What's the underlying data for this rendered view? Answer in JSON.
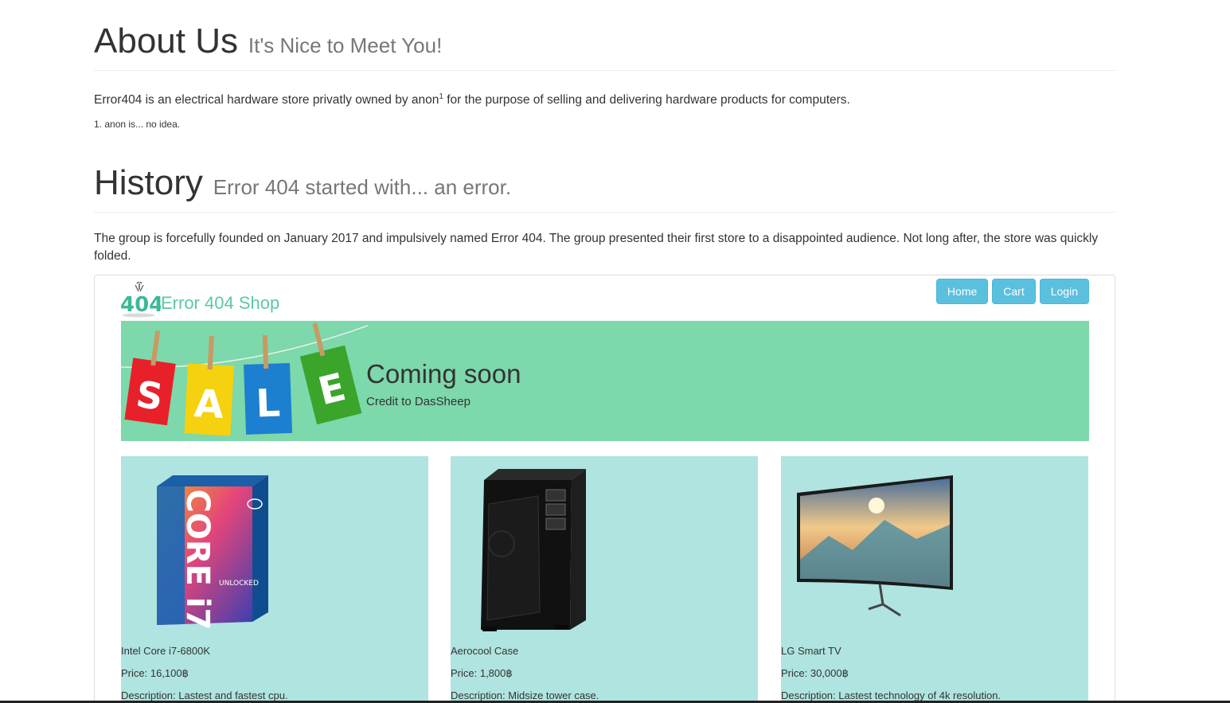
{
  "about": {
    "title": "About Us",
    "subtitle": "It's Nice to Meet You!",
    "text_before": "Error404 is an electrical hardware store privatly owned by anon",
    "footnote_marker": "1",
    "text_after": " for the purpose of selling and delivering hardware products for computers.",
    "footnote": "1. anon is... no idea."
  },
  "history": {
    "title": "History",
    "subtitle": "Error 404 started with... an error.",
    "text": "The group is forcefully founded on January 2017 and impulsively named Error 404. The group presented their first store to a disappointed audience. Not long after, the store was quickly folded."
  },
  "shop": {
    "brand_logo_text": "404",
    "brand_name": "Error 404 Shop",
    "nav": [
      "Home",
      "Cart",
      "Login"
    ],
    "banner": {
      "sale_letters": [
        "S",
        "A",
        "L",
        "E"
      ],
      "title": "Coming soon",
      "credit": "Credit to DasSheep"
    },
    "products": [
      {
        "name": "Intel Core i7-6800K",
        "price": "Price: 16,100฿",
        "description": "Description: Lastest and fastest cpu.",
        "box_text": "CORE i7",
        "box_sub": "UNLOCKED"
      },
      {
        "name": "Aerocool Case",
        "price": "Price: 1,800฿",
        "description": "Description: Midsize tower case."
      },
      {
        "name": "LG Smart TV",
        "price": "Price: 30,000฿",
        "description": "Description: Lastest technology of 4k resolution."
      }
    ]
  },
  "colors": {
    "banner_bg": "#7dd8ab",
    "card_bg": "#afe4e0",
    "nav_button": "#5bc0de",
    "brand_text": "#5cc9a0"
  }
}
